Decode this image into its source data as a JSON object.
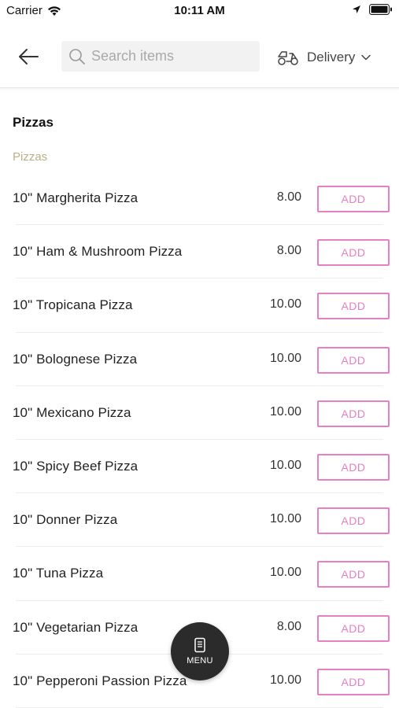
{
  "status_bar": {
    "carrier": "Carrier",
    "time": "10:11 AM"
  },
  "header": {
    "back_icon": "back-arrow-icon",
    "search_placeholder": "Search items",
    "delivery_label": "Delivery"
  },
  "section": {
    "title": "Pizzas",
    "subsection": "Pizzas"
  },
  "items": [
    {
      "name": "10\" Margherita Pizza",
      "price": "8.00",
      "add": "ADD"
    },
    {
      "name": "10\" Ham & Mushroom Pizza",
      "price": "8.00",
      "add": "ADD"
    },
    {
      "name": "10\" Tropicana Pizza",
      "price": "10.00",
      "add": "ADD"
    },
    {
      "name": "10\" Bolognese Pizza",
      "price": "10.00",
      "add": "ADD"
    },
    {
      "name": "10\" Mexicano Pizza",
      "price": "10.00",
      "add": "ADD"
    },
    {
      "name": "10\" Spicy Beef Pizza",
      "price": "10.00",
      "add": "ADD"
    },
    {
      "name": "10\" Donner Pizza",
      "price": "10.00",
      "add": "ADD"
    },
    {
      "name": "10\" Tuna Pizza",
      "price": "10.00",
      "add": "ADD"
    },
    {
      "name": "10\" Vegetarian Pizza",
      "price": "8.00",
      "add": "ADD"
    },
    {
      "name": "10\" Pepperoni Passion Pizza",
      "price": "10.00",
      "add": "ADD"
    }
  ],
  "menu_button": {
    "label": "MENU"
  },
  "colors": {
    "accent": "#e67fc3",
    "subsection": "#b8b08a",
    "fab": "#2b2b2b"
  }
}
